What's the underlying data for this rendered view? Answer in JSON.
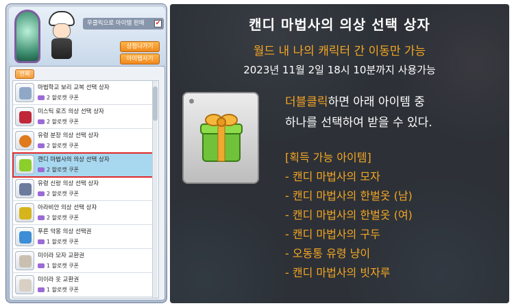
{
  "shop": {
    "checkbox_label": "우클릭으로 아이템 판매",
    "checkbox_checked": "✔",
    "buttons": {
      "shop": "상점나가기",
      "item": "아이템사기"
    },
    "tab_label": "전체",
    "items": [
      {
        "name": "마법학교 보리 교복 선택 상자",
        "price": "2 할로캣 쿠폰",
        "icon_color": "#8fa8c8"
      },
      {
        "name": "미스틱 로즈 의상 선택 상자",
        "price": "2 할로캣 쿠폰",
        "icon_color": "#c02838"
      },
      {
        "name": "유령 분장 의상 선택 상자",
        "price": "2 할로캣 쿠폰",
        "icon_color": "#e07a1c"
      },
      {
        "name": "캔디 마법사의 의상 선택 상자",
        "price": "2 할로캣 쿠폰",
        "icon_color": "#8ccf2a"
      },
      {
        "name": "유령 신랑 의상 선택 상자",
        "price": "2 할로캣 쿠폰",
        "icon_color": "#6c7a9c"
      },
      {
        "name": "아라비안 의상 선택 상자",
        "price": "2 할로캣 쿠폰",
        "icon_color": "#d6b41c"
      },
      {
        "name": "푸른 악몽 의상 선택권",
        "price": "1 할로캣 쿠폰",
        "icon_color": "#3d8ed6"
      },
      {
        "name": "미이라 모자 교환권",
        "price": "1 할로캣 쿠폰",
        "icon_color": "#c9c0b0"
      },
      {
        "name": "미이라 옷 교환권",
        "price": "1 할로캣 쿠폰",
        "icon_color": "#d8d0c2"
      }
    ]
  },
  "tooltip": {
    "title": "캔디 마법사의 의상 선택 상자",
    "subtitle": "월드 내 나의 캐릭터 간 이동만 가능",
    "expiry": "2023년 11월 2일 18시 10분까지 사용가능",
    "desc_highlight": "더블클릭",
    "desc_line1_rest": "하면 아래 아이템 중",
    "desc_line2": "하나를 선택하여 받을 수 있다.",
    "list_header": "[획득 가능 아이템]",
    "list_items": [
      "- 캔디 마법사의 모자",
      "- 캔디 마법사의 한벌옷 (남)",
      "- 캔디 마법사의 한벌옷 (여)",
      "- 캔디 마법사의 구두",
      "- 오동통 유령 냥이",
      "- 캔디 마법사의 빗자루"
    ]
  }
}
